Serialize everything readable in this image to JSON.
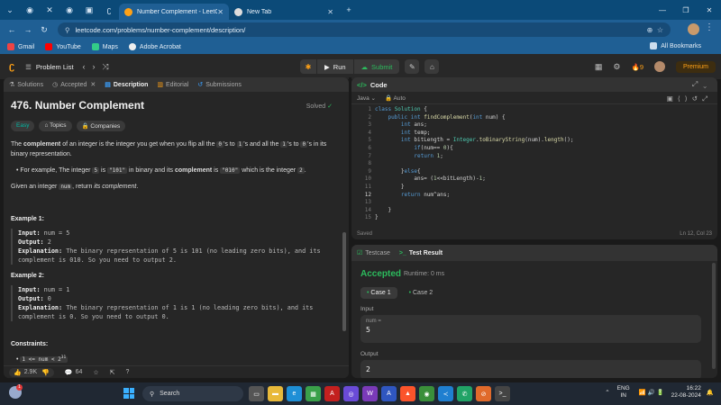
{
  "browser": {
    "tabs": [
      {
        "label": "Number Complement - LeetCo",
        "active": true
      },
      {
        "label": "New Tab",
        "active": false
      }
    ],
    "url": "leetcode.com/problems/number-complement/description/",
    "bookmarks": [
      "Gmail",
      "YouTube",
      "Maps",
      "Adobe Acrobat"
    ],
    "all_bookmarks": "All Bookmarks"
  },
  "nav": {
    "problem_list": "Problem List",
    "run": "Run",
    "submit": "Submit",
    "streak": "9",
    "premium": "Premium"
  },
  "left_tabs": [
    "Solutions",
    "Accepted",
    "Description",
    "Editorial",
    "Submissions"
  ],
  "problem": {
    "title": "476. Number Complement",
    "solved": "Solved",
    "tags": [
      "Easy",
      "Topics",
      "Companies"
    ],
    "p1_a": "The ",
    "p1_b": "complement",
    "p1_c": " of an integer is the integer you get when you flip all the ",
    "p1_d": "0",
    "p1_e": "'s to ",
    "p1_f": "1",
    "p1_g": "'s and all the ",
    "p1_h": "1",
    "p1_i": "'s to ",
    "p1_j": "0",
    "p1_k": "'s in its binary representation.",
    "bullet_a": "For example, The integer ",
    "bullet_b": "5",
    "bullet_c": " is ",
    "bullet_d": "\"101\"",
    "bullet_e": " in binary and its ",
    "bullet_f": "complement",
    "bullet_g": " is ",
    "bullet_h": "\"010\"",
    "bullet_i": " which is the integer ",
    "bullet_j": "2",
    "bullet_k": ".",
    "p2_a": "Given an integer ",
    "p2_b": "num",
    "p2_c": ", return ",
    "p2_d": "its complement",
    "p2_e": ".",
    "ex1_title": "Example 1:",
    "ex1_input_label": "Input:",
    "ex1_input": " num = 5",
    "ex1_output_label": "Output:",
    "ex1_output": " 2",
    "ex1_expl_label": "Explanation:",
    "ex1_expl_1": " The binary representation of 5 is 101 (no leading zero bits), and its",
    "ex1_expl_2": "complement is 010. So you need to output 2.",
    "ex2_title": "Example 2:",
    "ex2_input_label": "Input:",
    "ex2_input": " num = 1",
    "ex2_output_label": "Output:",
    "ex2_output": " 0",
    "ex2_expl_label": "Explanation:",
    "ex2_expl_1": " The binary representation of 1 is 1 (no leading zero bits), and its",
    "ex2_expl_2": "complement is 0. So you need to output 0.",
    "constraints_title": "Constraints:",
    "constraint_1": "1 <= num < 2",
    "constraint_1_sup": "31"
  },
  "footer": {
    "likes": "2.9K",
    "comments": "64"
  },
  "code": {
    "title": "Code",
    "language": "Java",
    "mode": "Auto",
    "lines": [
      "class Solution {",
      "    public int findComplement(int num) {",
      "        int ans;",
      "        int temp;",
      "        int bitLength = Integer.toBinaryString(num).length();",
      "            if(num== 0){",
      "            return 1;",
      "",
      "        }else{",
      "            ans= (1<<bitLength)-1;",
      "        }",
      "        return num^ans;",
      "",
      "    }",
      "}"
    ],
    "current_line": 12,
    "status": "Saved",
    "cursor": "Ln 12, Col 23"
  },
  "result": {
    "tabs": [
      "Testcase",
      "Test Result"
    ],
    "verdict": "Accepted",
    "runtime": "Runtime: 0 ms",
    "cases": [
      "Case 1",
      "Case 2"
    ],
    "input_label": "Input",
    "input_var": "num =",
    "input_value": "5",
    "output_label": "Output",
    "output_value": "2"
  },
  "taskbar": {
    "search": "Search",
    "weather_badge": "1",
    "lang_1": "ENG",
    "lang_2": "IN",
    "time": "16:22",
    "date": "22-08-2024"
  }
}
